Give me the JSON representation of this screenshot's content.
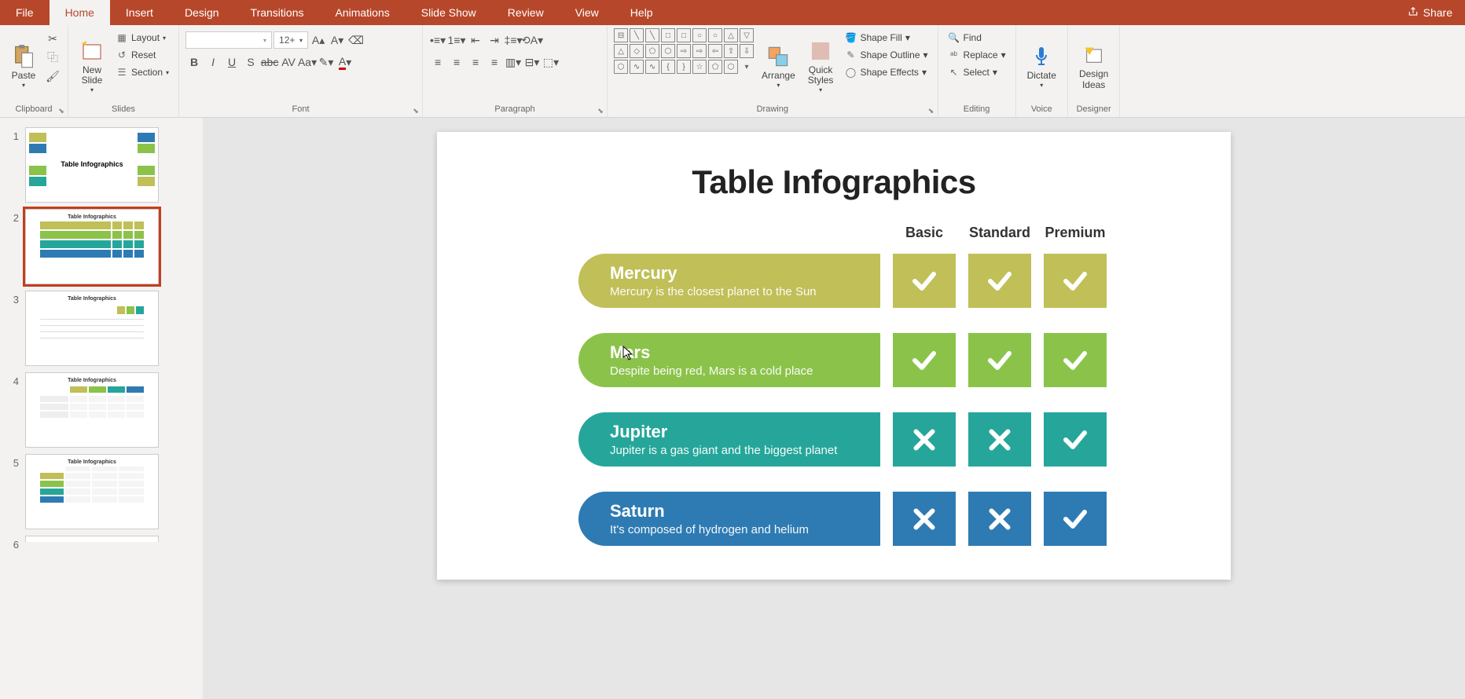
{
  "tabs": {
    "file": "File",
    "home": "Home",
    "insert": "Insert",
    "design": "Design",
    "transitions": "Transitions",
    "animations": "Animations",
    "slideshow": "Slide Show",
    "review": "Review",
    "view": "View",
    "help": "Help",
    "share": "Share"
  },
  "ribbon": {
    "clipboard": {
      "paste": "Paste",
      "label": "Clipboard"
    },
    "slides": {
      "new_slide": "New\nSlide",
      "layout": "Layout",
      "reset": "Reset",
      "section": "Section",
      "label": "Slides"
    },
    "font": {
      "font_name": "",
      "font_size": "12+",
      "label": "Font"
    },
    "paragraph": {
      "label": "Paragraph"
    },
    "drawing": {
      "arrange": "Arrange",
      "quick_styles": "Quick\nStyles",
      "shape_fill": "Shape Fill",
      "shape_outline": "Shape Outline",
      "shape_effects": "Shape Effects",
      "label": "Drawing"
    },
    "editing": {
      "find": "Find",
      "replace": "Replace",
      "select": "Select",
      "label": "Editing"
    },
    "voice": {
      "dictate": "Dictate",
      "label": "Voice"
    },
    "designer": {
      "design_ideas": "Design\nIdeas",
      "label": "Designer"
    }
  },
  "thumbs": [
    {
      "num": "1",
      "title": "Table Infographics"
    },
    {
      "num": "2",
      "title": "Table Infographics"
    },
    {
      "num": "3",
      "title": "Table Infographics"
    },
    {
      "num": "4",
      "title": "Table Infographics"
    },
    {
      "num": "5",
      "title": "Table Infographics"
    },
    {
      "num": "6",
      "title": ""
    }
  ],
  "slide": {
    "title": "Table Infographics",
    "columns": [
      "Basic",
      "Standard",
      "Premium"
    ],
    "rows": [
      {
        "name": "Mercury",
        "desc": "Mercury is the closest planet to the Sun",
        "color": "c-olive",
        "cells": [
          "check",
          "check",
          "check"
        ]
      },
      {
        "name": "Mars",
        "desc": "Despite being red, Mars is a cold place",
        "color": "c-green",
        "cells": [
          "check",
          "check",
          "check"
        ]
      },
      {
        "name": "Jupiter",
        "desc": "Jupiter is a gas giant and the biggest planet",
        "color": "c-teal",
        "cells": [
          "cross",
          "cross",
          "check"
        ]
      },
      {
        "name": "Saturn",
        "desc": "It's composed of hydrogen and helium",
        "color": "c-blue",
        "cells": [
          "cross",
          "cross",
          "check"
        ]
      }
    ]
  }
}
